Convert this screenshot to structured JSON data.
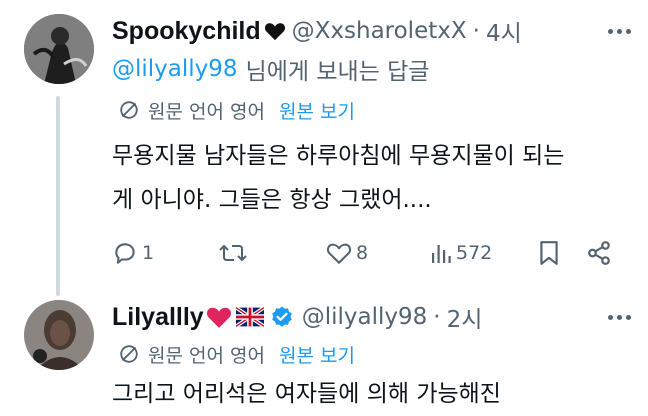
{
  "tweet1": {
    "display_name": "Spookychild",
    "handle": "@XxsharoletxX",
    "separator": "·",
    "time": "4시",
    "reply_to_handle": "@lilyally98",
    "reply_to_suffix": "님에게 보내는 답글",
    "translate_info": "원문 언어 영어",
    "show_original": "원본 보기",
    "text_line1": "무용지물 남자들은 하루아침에 무용지물이 되는",
    "text_line2": "게 아니야. 그들은 항상 그랬어....",
    "actions": {
      "reply_count": "1",
      "like_count": "8",
      "view_count": "572"
    }
  },
  "tweet2": {
    "display_name": "Lilyallly",
    "emoji_heart": "❤️",
    "emoji_flag": "🇬🇧",
    "handle": "@lilyally98",
    "separator": "·",
    "time": "2시",
    "translate_info": "원문 언어 영어",
    "show_original": "원본 보기",
    "text_line1": "그리고 어리석은 여자들에 의해 가능해진"
  },
  "colors": {
    "text": "#0f1419",
    "secondary": "#536471",
    "accent": "#1d9bf0",
    "verified": "#1d9bf0",
    "heart": "#e0245e"
  },
  "icons": {
    "black_heart": "black-heart-icon",
    "translate": "translate-icon",
    "reply": "reply-icon",
    "retweet": "retweet-icon",
    "like": "like-icon",
    "views": "views-icon",
    "bookmark": "bookmark-icon",
    "share": "share-icon",
    "more": "more-icon",
    "verified": "verified-badge-icon"
  }
}
